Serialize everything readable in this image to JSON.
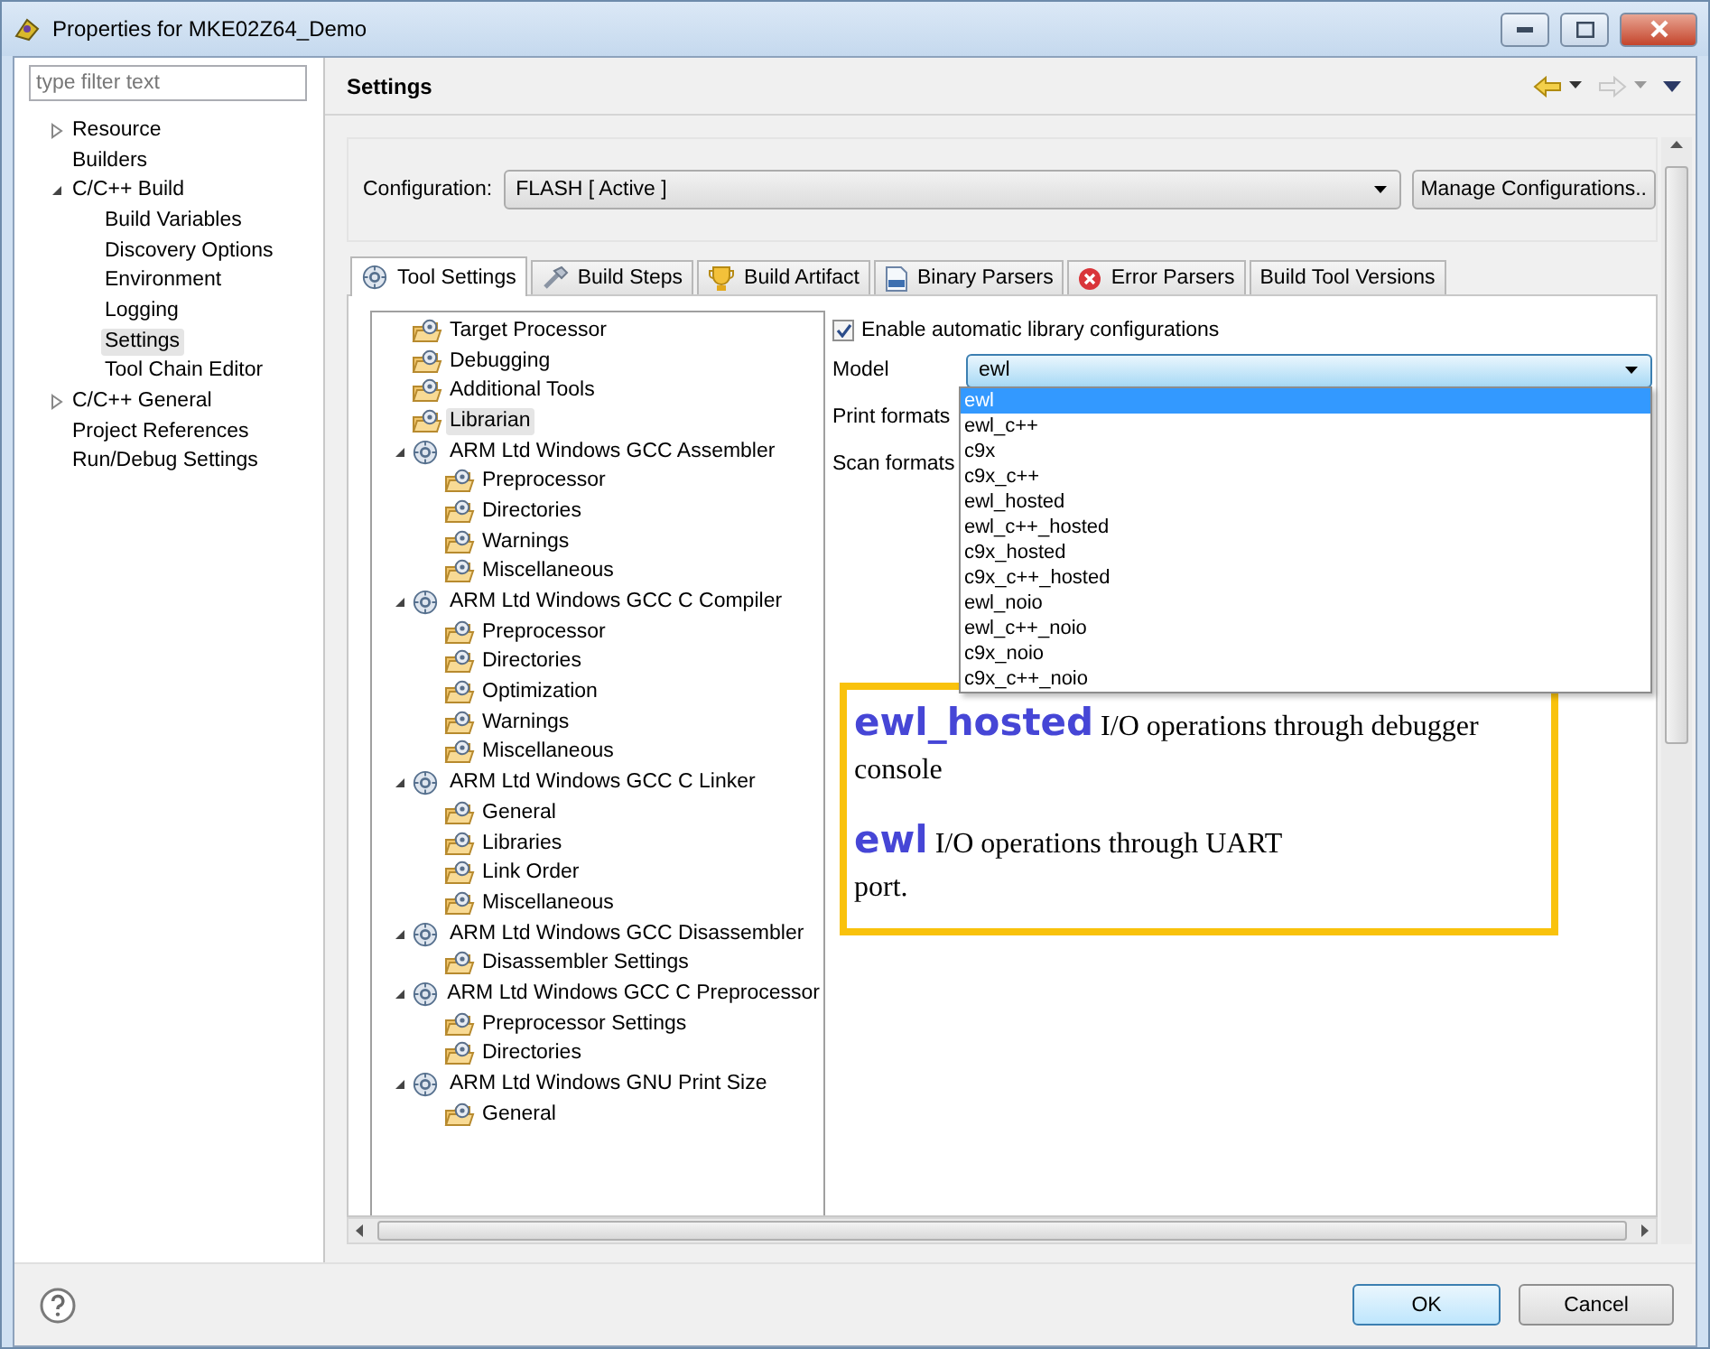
{
  "window": {
    "title": "Properties for MKE02Z64_Demo"
  },
  "sidebar": {
    "filter_placeholder": "type filter text",
    "items": [
      {
        "label": "Resource",
        "expanded": false,
        "selected": false
      },
      {
        "label": "Builders",
        "selected": false
      },
      {
        "label": "C/C++ Build",
        "expanded": true,
        "selected": false,
        "children": [
          {
            "label": "Build Variables",
            "selected": false
          },
          {
            "label": "Discovery Options",
            "selected": false
          },
          {
            "label": "Environment",
            "selected": false
          },
          {
            "label": "Logging",
            "selected": false
          },
          {
            "label": "Settings",
            "selected": true
          },
          {
            "label": "Tool Chain Editor",
            "selected": false
          }
        ]
      },
      {
        "label": "C/C++ General",
        "expanded": false,
        "selected": false
      },
      {
        "label": "Project References",
        "selected": false
      },
      {
        "label": "Run/Debug Settings",
        "selected": false
      }
    ]
  },
  "page": {
    "title": "Settings"
  },
  "configuration": {
    "label": "Configuration:",
    "value": "FLASH  [ Active ]",
    "manage_button": "Manage Configurations.."
  },
  "tabs": [
    {
      "label": "Tool Settings",
      "selected": true
    },
    {
      "label": "Build Steps",
      "selected": false
    },
    {
      "label": "Build Artifact",
      "selected": false
    },
    {
      "label": "Binary Parsers",
      "selected": false
    },
    {
      "label": "Error Parsers",
      "selected": false
    },
    {
      "label": "Build Tool Versions",
      "selected": false
    }
  ],
  "tool_tree": [
    {
      "label": "Target Processor",
      "selected": false
    },
    {
      "label": "Debugging",
      "selected": false
    },
    {
      "label": "Additional Tools",
      "selected": false
    },
    {
      "label": "Librarian",
      "selected": true
    },
    {
      "label": "ARM Ltd Windows GCC Assembler",
      "expanded": true,
      "selected": false,
      "children": [
        {
          "label": "Preprocessor",
          "selected": false
        },
        {
          "label": "Directories",
          "selected": false
        },
        {
          "label": "Warnings",
          "selected": false
        },
        {
          "label": "Miscellaneous",
          "selected": false
        }
      ]
    },
    {
      "label": "ARM Ltd Windows GCC C Compiler",
      "expanded": true,
      "selected": false,
      "children": [
        {
          "label": "Preprocessor",
          "selected": false
        },
        {
          "label": "Directories",
          "selected": false
        },
        {
          "label": "Optimization",
          "selected": false
        },
        {
          "label": "Warnings",
          "selected": false
        },
        {
          "label": "Miscellaneous",
          "selected": false
        }
      ]
    },
    {
      "label": "ARM Ltd Windows GCC C Linker",
      "expanded": true,
      "selected": false,
      "children": [
        {
          "label": "General",
          "selected": false
        },
        {
          "label": "Libraries",
          "selected": false
        },
        {
          "label": "Link Order",
          "selected": false
        },
        {
          "label": "Miscellaneous",
          "selected": false
        }
      ]
    },
    {
      "label": "ARM Ltd Windows GCC Disassembler",
      "expanded": true,
      "selected": false,
      "children": [
        {
          "label": "Disassembler Settings",
          "selected": false
        }
      ]
    },
    {
      "label": "ARM Ltd Windows GCC C Preprocessor",
      "expanded": true,
      "selected": false,
      "children": [
        {
          "label": "Preprocessor Settings",
          "selected": false
        },
        {
          "label": "Directories",
          "selected": false
        }
      ]
    },
    {
      "label": "ARM Ltd Windows GNU Print Size",
      "expanded": true,
      "selected": false,
      "children": [
        {
          "label": "General",
          "selected": false
        }
      ]
    }
  ],
  "options": {
    "auto_library": {
      "label": "Enable automatic library configurations",
      "checked": true
    },
    "model": {
      "label": "Model",
      "value": "ewl",
      "expanded": true,
      "options": [
        {
          "label": "ewl",
          "selected": true
        },
        {
          "label": "ewl_c++",
          "selected": false
        },
        {
          "label": "c9x",
          "selected": false
        },
        {
          "label": "c9x_c++",
          "selected": false
        },
        {
          "label": "ewl_hosted",
          "selected": false
        },
        {
          "label": "ewl_c++_hosted",
          "selected": false
        },
        {
          "label": "c9x_hosted",
          "selected": false
        },
        {
          "label": "c9x_c++_hosted",
          "selected": false
        },
        {
          "label": "ewl_noio",
          "selected": false
        },
        {
          "label": "ewl_c++_noio",
          "selected": false
        },
        {
          "label": "c9x_noio",
          "selected": false
        },
        {
          "label": "c9x_c++_noio",
          "selected": false
        }
      ]
    },
    "print_formats": {
      "label": "Print formats"
    },
    "scan_formats": {
      "label": "Scan formats"
    }
  },
  "annotation": {
    "paragraphs": [
      "**ewl_hosted** I/O operations through debugger console",
      "**ewl** I/O operations through UART port."
    ]
  },
  "buttons": [
    {
      "label": "OK",
      "default": true
    },
    {
      "label": "Cancel",
      "default": false
    }
  ]
}
